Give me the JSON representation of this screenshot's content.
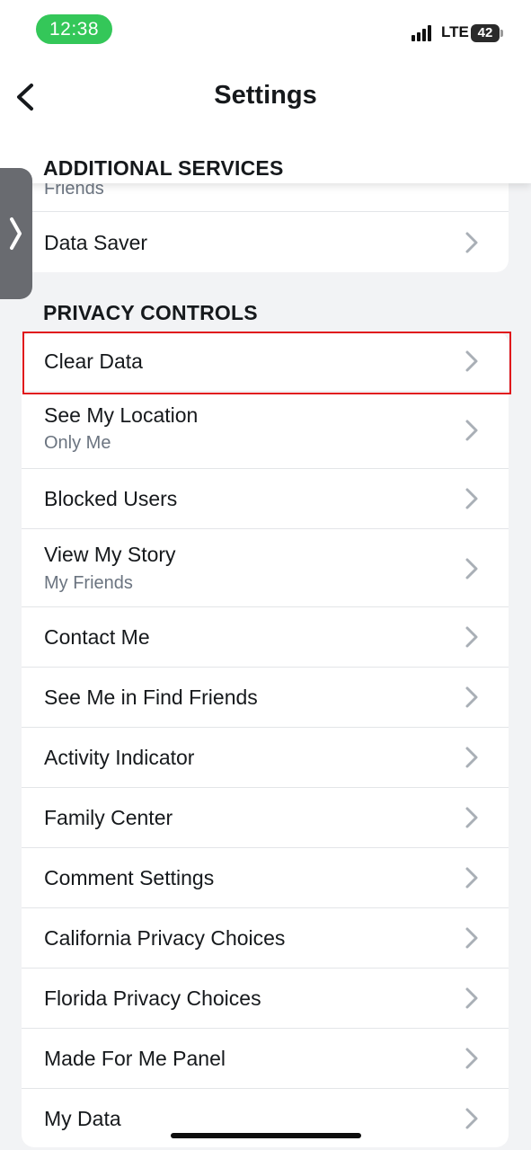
{
  "status_bar": {
    "time": "12:38",
    "carrier": "LTE",
    "battery": "42",
    "time_pill_color": "#34c759"
  },
  "header": {
    "title": "Settings",
    "back_icon": "chevron-left-icon"
  },
  "additional_services": {
    "title": "ADDITIONAL SERVICES",
    "items": [
      {
        "label": "Friends"
      },
      {
        "label": "Data Saver"
      }
    ]
  },
  "privacy_controls": {
    "title": "PRIVACY CONTROLS",
    "items": [
      {
        "label": "Clear Data"
      },
      {
        "label": "See My Location",
        "subtitle": "Only Me"
      },
      {
        "label": "Blocked Users"
      },
      {
        "label": "View My Story",
        "subtitle": "My Friends"
      },
      {
        "label": "Contact Me"
      },
      {
        "label": "See Me in Find Friends"
      },
      {
        "label": "Activity Indicator"
      },
      {
        "label": "Family Center"
      },
      {
        "label": "Comment Settings"
      },
      {
        "label": "California Privacy Choices"
      },
      {
        "label": "Florida Privacy Choices"
      },
      {
        "label": "Made For Me Panel"
      },
      {
        "label": "My Data"
      }
    ]
  },
  "colors": {
    "highlight": "#e0141b",
    "chevron": "#a9afb6",
    "background": "#f2f3f5"
  }
}
